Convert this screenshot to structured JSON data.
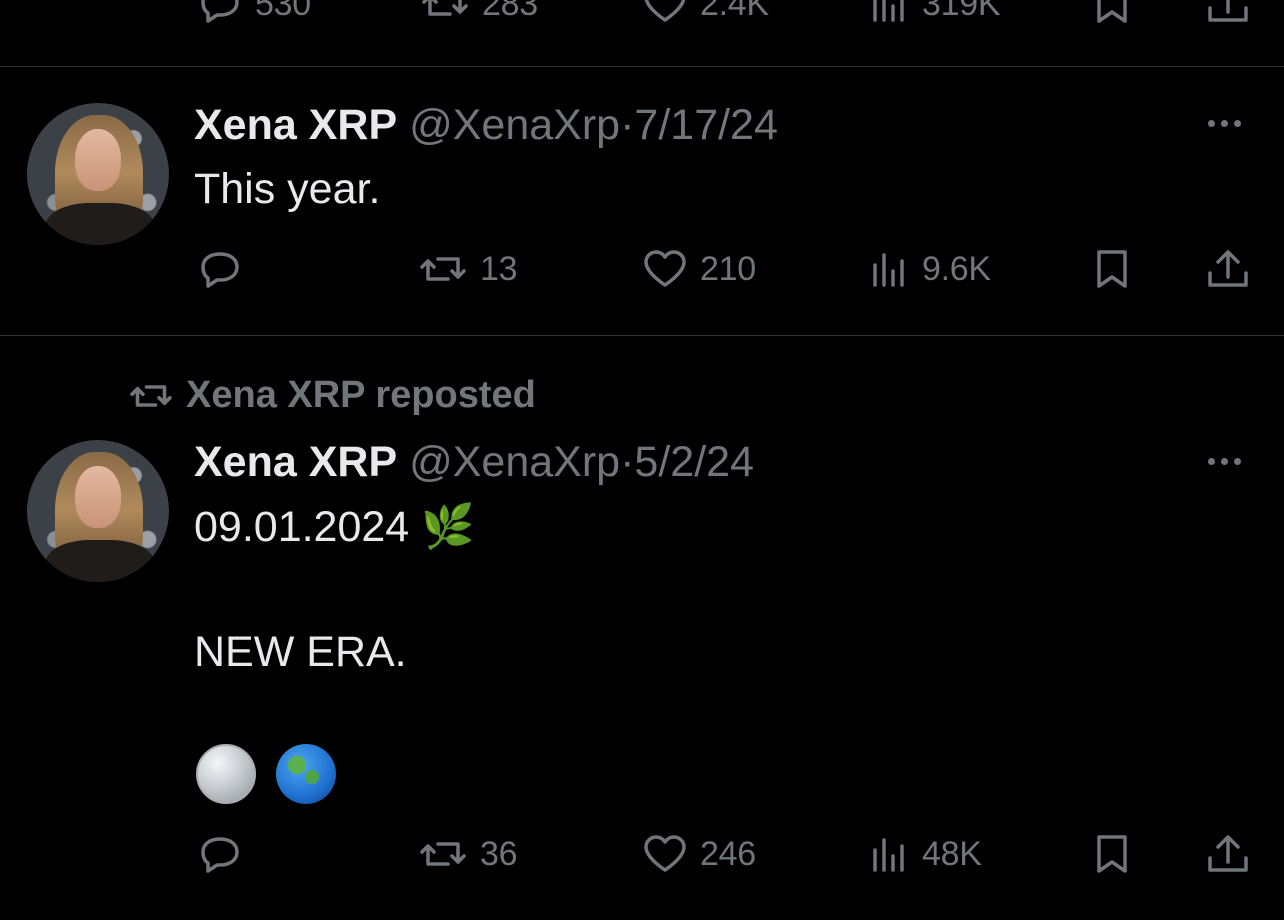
{
  "top_actions": {
    "reply_count": "530",
    "repost_count": "283",
    "like_count": "2.4K",
    "views_count": "319K"
  },
  "tweets": [
    {
      "author_name": "Xena XRP",
      "handle": "@XenaXrp",
      "separator": "·",
      "date": "7/17/24",
      "text": "This year.",
      "reply_count": "",
      "repost_count": "13",
      "like_count": "210",
      "views_count": "9.6K"
    },
    {
      "repost_label": "Xena XRP reposted",
      "author_name": "Xena XRP",
      "handle": "@XenaXrp",
      "separator": "·",
      "date": "5/2/24",
      "text_line1": "09.01.2024 🌿",
      "text_line2": "NEW ERA.",
      "emojis": [
        "coin-emoji",
        "globe-emoji"
      ],
      "reply_count": "",
      "repost_count": "36",
      "like_count": "246",
      "views_count": "48K"
    }
  ],
  "colors": {
    "background": "#000000",
    "text_primary": "#e7e9ea",
    "text_secondary": "#71767b",
    "divider": "#2f3336"
  }
}
